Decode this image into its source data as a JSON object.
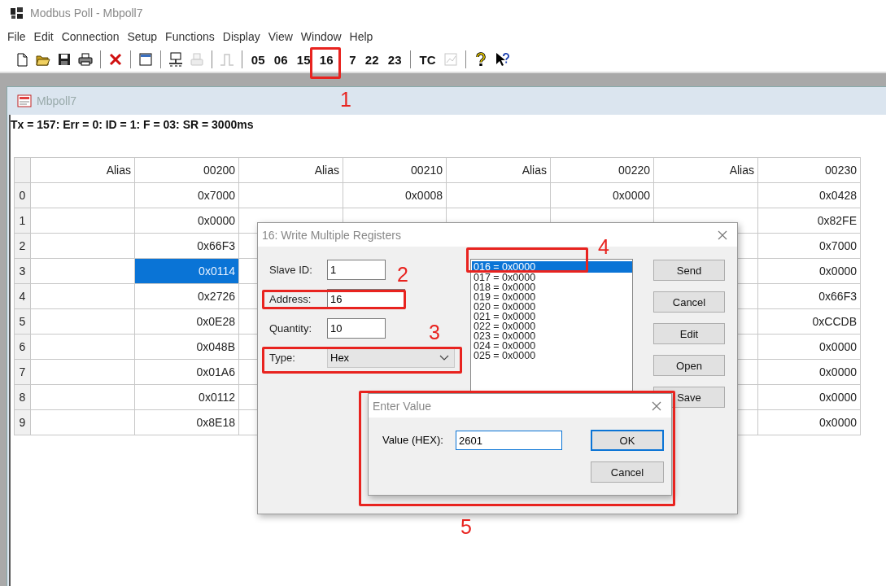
{
  "window": {
    "title": "Modbus Poll - Mbpoll7"
  },
  "menu": [
    "File",
    "Edit",
    "Connection",
    "Setup",
    "Functions",
    "Display",
    "View",
    "Window",
    "Help"
  ],
  "toolbar": [
    {
      "kind": "icon",
      "disabled": false
    },
    {
      "kind": "icon",
      "disabled": false
    },
    {
      "kind": "icon",
      "disabled": false
    },
    {
      "kind": "icon",
      "disabled": false
    },
    {
      "kind": "separator"
    },
    {
      "kind": "icon",
      "disabled": false
    },
    {
      "kind": "separator"
    },
    {
      "kind": "icon",
      "disabled": false
    },
    {
      "kind": "separator"
    },
    {
      "kind": "icon",
      "disabled": false
    },
    {
      "kind": "icon",
      "disabled": true
    },
    {
      "kind": "separator"
    },
    {
      "kind": "icon",
      "disabled": true
    },
    {
      "kind": "separator"
    },
    {
      "kind": "text",
      "label": "05"
    },
    {
      "kind": "text",
      "label": "06"
    },
    {
      "kind": "text",
      "label": "15"
    },
    {
      "kind": "text",
      "label": "16"
    },
    {
      "kind": "text",
      "label": "7"
    },
    {
      "kind": "text",
      "label": "22"
    },
    {
      "kind": "text",
      "label": "23"
    },
    {
      "kind": "separator"
    },
    {
      "kind": "text",
      "label": "TC"
    },
    {
      "kind": "icon",
      "disabled": true
    },
    {
      "kind": "separator"
    },
    {
      "kind": "icon",
      "disabled": false
    },
    {
      "kind": "icon",
      "disabled": false
    }
  ],
  "child_window": {
    "title": "Mbpoll7",
    "status": "Tx = 157: Err = 0: ID = 1: F = 03: SR = 3000ms"
  },
  "table": {
    "row_headers": [
      "0",
      "1",
      "2",
      "3",
      "4",
      "5",
      "6",
      "7",
      "8",
      "9"
    ],
    "columns": [
      {
        "header": "Alias"
      },
      {
        "header": "00200",
        "values": [
          {
            "text": "0x7000",
            "selected": false
          },
          {
            "text": "0x0000",
            "selected": false
          },
          {
            "text": "0x66F3",
            "selected": false
          },
          {
            "text": "0x0114",
            "selected": true
          },
          {
            "text": "0x2726",
            "selected": false
          },
          {
            "text": "0x0E28",
            "selected": false
          },
          {
            "text": "0x048B",
            "selected": false
          },
          {
            "text": "0x01A6",
            "selected": false
          },
          {
            "text": "0x0112",
            "selected": false
          },
          {
            "text": "0x8E18",
            "selected": false
          }
        ]
      },
      {
        "header": "Alias"
      },
      {
        "header": "00210",
        "values": [
          {
            "text": "0x0008",
            "selected": false
          }
        ]
      },
      {
        "header": "Alias"
      },
      {
        "header": "00220",
        "values": [
          {
            "text": "0x0000",
            "selected": false
          }
        ]
      },
      {
        "header": "Alias"
      },
      {
        "header": "00230",
        "values": [
          {
            "text": "0x0428",
            "selected": false
          },
          {
            "text": "0x82FE",
            "selected": false
          },
          {
            "text": "0x7000",
            "selected": false
          },
          {
            "text": "0x0000",
            "selected": false
          },
          {
            "text": "0x66F3",
            "selected": false
          },
          {
            "text": "0xCCDB",
            "selected": false
          },
          {
            "text": "0x0000",
            "selected": false
          },
          {
            "text": "0x0000",
            "selected": false
          },
          {
            "text": "0x0000",
            "selected": false
          },
          {
            "text": "0x0000",
            "selected": false
          }
        ]
      }
    ]
  },
  "write_dialog": {
    "title": "16: Write Multiple Registers",
    "fields": [
      {
        "label": "Slave ID:",
        "value": "1"
      },
      {
        "label": "Address:",
        "value": "16"
      },
      {
        "label": "Quantity:",
        "value": "10"
      }
    ],
    "type": {
      "label": "Type:",
      "value": "Hex"
    },
    "registers": [
      {
        "text": "016 = 0x0000",
        "selected": true
      },
      {
        "text": "017 = 0x0000",
        "selected": false
      },
      {
        "text": "018 = 0x0000",
        "selected": false
      },
      {
        "text": "019 = 0x0000",
        "selected": false
      },
      {
        "text": "020 = 0x0000",
        "selected": false
      },
      {
        "text": "021 = 0x0000",
        "selected": false
      },
      {
        "text": "022 = 0x0000",
        "selected": false
      },
      {
        "text": "023 = 0x0000",
        "selected": false
      },
      {
        "text": "024 = 0x0000",
        "selected": false
      },
      {
        "text": "025 = 0x0000",
        "selected": false
      }
    ],
    "buttons": [
      "Send",
      "Cancel",
      "Edit",
      "Open",
      "Save"
    ]
  },
  "value_dialog": {
    "title": "Enter Value",
    "label": "Value (HEX):",
    "value": "2601",
    "buttons": [
      {
        "label": "OK",
        "focused": true
      },
      {
        "label": "Cancel",
        "focused": false
      }
    ]
  },
  "annotations": [
    {
      "label": "1"
    },
    {
      "label": "2"
    },
    {
      "label": "3"
    },
    {
      "label": "4"
    },
    {
      "label": "5"
    }
  ]
}
